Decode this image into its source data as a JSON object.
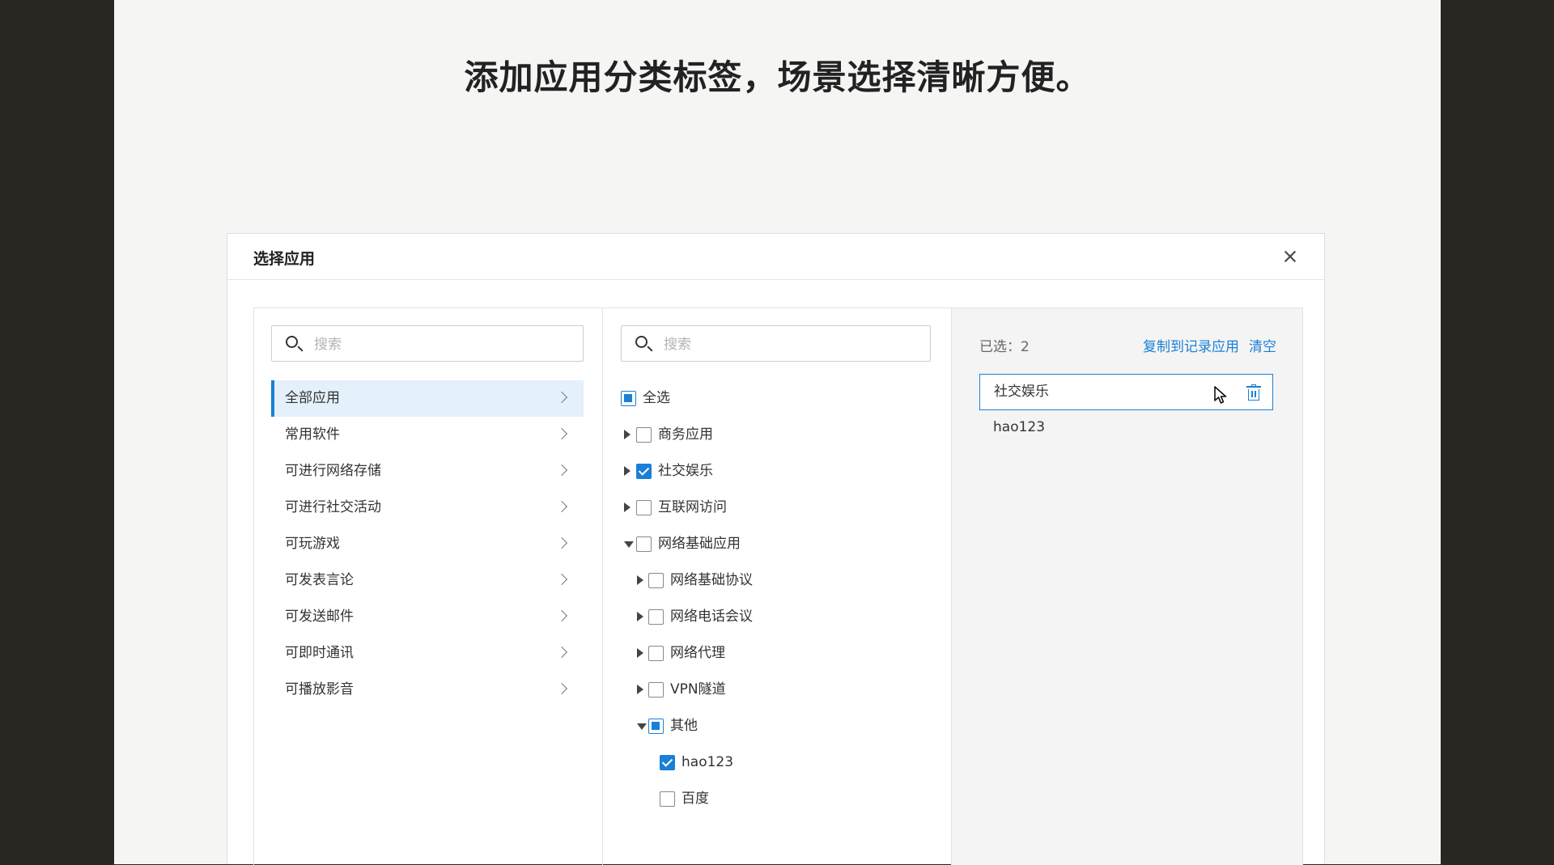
{
  "headline": "添加应用分类标签，场景选择清晰方便。",
  "modal": {
    "title": "选择应用"
  },
  "left_pane": {
    "search_placeholder": "搜索",
    "categories": [
      {
        "label": "全部应用",
        "active": true
      },
      {
        "label": "常用软件",
        "active": false
      },
      {
        "label": "可进行网络存储",
        "active": false
      },
      {
        "label": "可进行社交活动",
        "active": false
      },
      {
        "label": "可玩游戏",
        "active": false
      },
      {
        "label": "可发表言论",
        "active": false
      },
      {
        "label": "可发送邮件",
        "active": false
      },
      {
        "label": "可即时通讯",
        "active": false
      },
      {
        "label": "可播放影音",
        "active": false
      }
    ]
  },
  "mid_pane": {
    "search_placeholder": "搜索",
    "tree": [
      {
        "label": "全选",
        "level": 0,
        "expander": "none",
        "check": "partial"
      },
      {
        "label": "商务应用",
        "level": 1,
        "expander": "right",
        "check": "unchecked"
      },
      {
        "label": "社交娱乐",
        "level": 1,
        "expander": "right",
        "check": "checked"
      },
      {
        "label": "互联网访问",
        "level": 1,
        "expander": "right",
        "check": "unchecked"
      },
      {
        "label": "网络基础应用",
        "level": 1,
        "expander": "down",
        "check": "unchecked"
      },
      {
        "label": "网络基础协议",
        "level": 2,
        "expander": "right",
        "check": "unchecked"
      },
      {
        "label": "网络电话会议",
        "level": 2,
        "expander": "right",
        "check": "unchecked"
      },
      {
        "label": "网络代理",
        "level": 2,
        "expander": "right",
        "check": "unchecked"
      },
      {
        "label": "VPN隧道",
        "level": 2,
        "expander": "right",
        "check": "unchecked"
      },
      {
        "label": "其他",
        "level": 2,
        "expander": "down",
        "check": "partial"
      },
      {
        "label": "hao123",
        "level": 3,
        "expander": "none",
        "check": "checked"
      },
      {
        "label": "百度",
        "level": 3,
        "expander": "none",
        "check": "unchecked"
      }
    ]
  },
  "right_pane": {
    "selected_count_label": "已选：2",
    "copy_action": "复制到记录应用",
    "clear_action": "清空",
    "selected_items": [
      "社交娱乐",
      "hao123"
    ]
  },
  "colors": {
    "accent": "#1a7fd6",
    "active_row_bg": "#e4f0fb",
    "right_pane_bg": "#f4f4f4"
  }
}
